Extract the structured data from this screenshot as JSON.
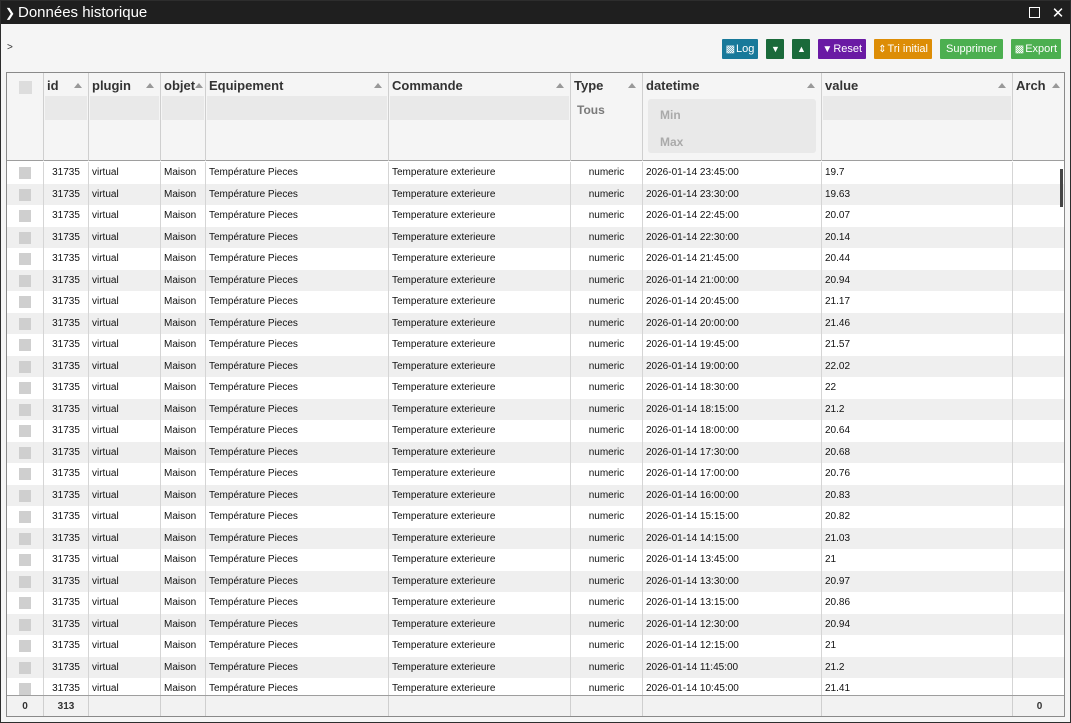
{
  "window": {
    "title": "Données historique"
  },
  "breadcrumb": ">",
  "toolbar": {
    "log_label": "Log",
    "reset_label": "Reset",
    "tri_label": "Tri initial",
    "supprimer_label": "Supprimer",
    "export_label": "Export"
  },
  "columns": [
    {
      "key": "check",
      "label": ""
    },
    {
      "key": "id",
      "label": "id"
    },
    {
      "key": "plugin",
      "label": "plugin"
    },
    {
      "key": "objet",
      "label": "objet"
    },
    {
      "key": "equipement",
      "label": "Equipement"
    },
    {
      "key": "commande",
      "label": "Commande"
    },
    {
      "key": "type",
      "label": "Type"
    },
    {
      "key": "datetime",
      "label": "datetime"
    },
    {
      "key": "value",
      "label": "value"
    },
    {
      "key": "arch",
      "label": "Arch"
    }
  ],
  "filters": {
    "type": "Tous",
    "datetime_min": "Min",
    "datetime_max": "Max"
  },
  "rows": [
    {
      "id": "31735",
      "plugin": "virtual",
      "objet": "Maison",
      "equipement": "Température Pieces",
      "commande": "Temperature exterieure",
      "type": "numeric",
      "datetime": "2026-01-14 23:45:00",
      "value": "19.7"
    },
    {
      "id": "31735",
      "plugin": "virtual",
      "objet": "Maison",
      "equipement": "Température Pieces",
      "commande": "Temperature exterieure",
      "type": "numeric",
      "datetime": "2026-01-14 23:30:00",
      "value": "19.63"
    },
    {
      "id": "31735",
      "plugin": "virtual",
      "objet": "Maison",
      "equipement": "Température Pieces",
      "commande": "Temperature exterieure",
      "type": "numeric",
      "datetime": "2026-01-14 22:45:00",
      "value": "20.07"
    },
    {
      "id": "31735",
      "plugin": "virtual",
      "objet": "Maison",
      "equipement": "Température Pieces",
      "commande": "Temperature exterieure",
      "type": "numeric",
      "datetime": "2026-01-14 22:30:00",
      "value": "20.14"
    },
    {
      "id": "31735",
      "plugin": "virtual",
      "objet": "Maison",
      "equipement": "Température Pieces",
      "commande": "Temperature exterieure",
      "type": "numeric",
      "datetime": "2026-01-14 21:45:00",
      "value": "20.44"
    },
    {
      "id": "31735",
      "plugin": "virtual",
      "objet": "Maison",
      "equipement": "Température Pieces",
      "commande": "Temperature exterieure",
      "type": "numeric",
      "datetime": "2026-01-14 21:00:00",
      "value": "20.94"
    },
    {
      "id": "31735",
      "plugin": "virtual",
      "objet": "Maison",
      "equipement": "Température Pieces",
      "commande": "Temperature exterieure",
      "type": "numeric",
      "datetime": "2026-01-14 20:45:00",
      "value": "21.17"
    },
    {
      "id": "31735",
      "plugin": "virtual",
      "objet": "Maison",
      "equipement": "Température Pieces",
      "commande": "Temperature exterieure",
      "type": "numeric",
      "datetime": "2026-01-14 20:00:00",
      "value": "21.46"
    },
    {
      "id": "31735",
      "plugin": "virtual",
      "objet": "Maison",
      "equipement": "Température Pieces",
      "commande": "Temperature exterieure",
      "type": "numeric",
      "datetime": "2026-01-14 19:45:00",
      "value": "21.57"
    },
    {
      "id": "31735",
      "plugin": "virtual",
      "objet": "Maison",
      "equipement": "Température Pieces",
      "commande": "Temperature exterieure",
      "type": "numeric",
      "datetime": "2026-01-14 19:00:00",
      "value": "22.02"
    },
    {
      "id": "31735",
      "plugin": "virtual",
      "objet": "Maison",
      "equipement": "Température Pieces",
      "commande": "Temperature exterieure",
      "type": "numeric",
      "datetime": "2026-01-14 18:30:00",
      "value": "22"
    },
    {
      "id": "31735",
      "plugin": "virtual",
      "objet": "Maison",
      "equipement": "Température Pieces",
      "commande": "Temperature exterieure",
      "type": "numeric",
      "datetime": "2026-01-14 18:15:00",
      "value": "21.2"
    },
    {
      "id": "31735",
      "plugin": "virtual",
      "objet": "Maison",
      "equipement": "Température Pieces",
      "commande": "Temperature exterieure",
      "type": "numeric",
      "datetime": "2026-01-14 18:00:00",
      "value": "20.64"
    },
    {
      "id": "31735",
      "plugin": "virtual",
      "objet": "Maison",
      "equipement": "Température Pieces",
      "commande": "Temperature exterieure",
      "type": "numeric",
      "datetime": "2026-01-14 17:30:00",
      "value": "20.68"
    },
    {
      "id": "31735",
      "plugin": "virtual",
      "objet": "Maison",
      "equipement": "Température Pieces",
      "commande": "Temperature exterieure",
      "type": "numeric",
      "datetime": "2026-01-14 17:00:00",
      "value": "20.76"
    },
    {
      "id": "31735",
      "plugin": "virtual",
      "objet": "Maison",
      "equipement": "Température Pieces",
      "commande": "Temperature exterieure",
      "type": "numeric",
      "datetime": "2026-01-14 16:00:00",
      "value": "20.83"
    },
    {
      "id": "31735",
      "plugin": "virtual",
      "objet": "Maison",
      "equipement": "Température Pieces",
      "commande": "Temperature exterieure",
      "type": "numeric",
      "datetime": "2026-01-14 15:15:00",
      "value": "20.82"
    },
    {
      "id": "31735",
      "plugin": "virtual",
      "objet": "Maison",
      "equipement": "Température Pieces",
      "commande": "Temperature exterieure",
      "type": "numeric",
      "datetime": "2026-01-14 14:15:00",
      "value": "21.03"
    },
    {
      "id": "31735",
      "plugin": "virtual",
      "objet": "Maison",
      "equipement": "Température Pieces",
      "commande": "Temperature exterieure",
      "type": "numeric",
      "datetime": "2026-01-14 13:45:00",
      "value": "21"
    },
    {
      "id": "31735",
      "plugin": "virtual",
      "objet": "Maison",
      "equipement": "Température Pieces",
      "commande": "Temperature exterieure",
      "type": "numeric",
      "datetime": "2026-01-14 13:30:00",
      "value": "20.97"
    },
    {
      "id": "31735",
      "plugin": "virtual",
      "objet": "Maison",
      "equipement": "Température Pieces",
      "commande": "Temperature exterieure",
      "type": "numeric",
      "datetime": "2026-01-14 13:15:00",
      "value": "20.86"
    },
    {
      "id": "31735",
      "plugin": "virtual",
      "objet": "Maison",
      "equipement": "Température Pieces",
      "commande": "Temperature exterieure",
      "type": "numeric",
      "datetime": "2026-01-14 12:30:00",
      "value": "20.94"
    },
    {
      "id": "31735",
      "plugin": "virtual",
      "objet": "Maison",
      "equipement": "Température Pieces",
      "commande": "Temperature exterieure",
      "type": "numeric",
      "datetime": "2026-01-14 12:15:00",
      "value": "21"
    },
    {
      "id": "31735",
      "plugin": "virtual",
      "objet": "Maison",
      "equipement": "Température Pieces",
      "commande": "Temperature exterieure",
      "type": "numeric",
      "datetime": "2026-01-14 11:45:00",
      "value": "21.2"
    },
    {
      "id": "31735",
      "plugin": "virtual",
      "objet": "Maison",
      "equipement": "Température Pieces",
      "commande": "Temperature exterieure",
      "type": "numeric",
      "datetime": "2026-01-14 10:45:00",
      "value": "21.41"
    }
  ],
  "footer": {
    "check_count": "0",
    "id_count": "313",
    "arch_count": "0"
  },
  "colors": {
    "titlebar": "#1f1f1f",
    "log": "#18799a",
    "chevrons": "#1a6a3a",
    "reset": "#6a1aa4",
    "tri_initial": "#dd8d06",
    "supprimer": "#4caf50",
    "export": "#4caf50"
  }
}
